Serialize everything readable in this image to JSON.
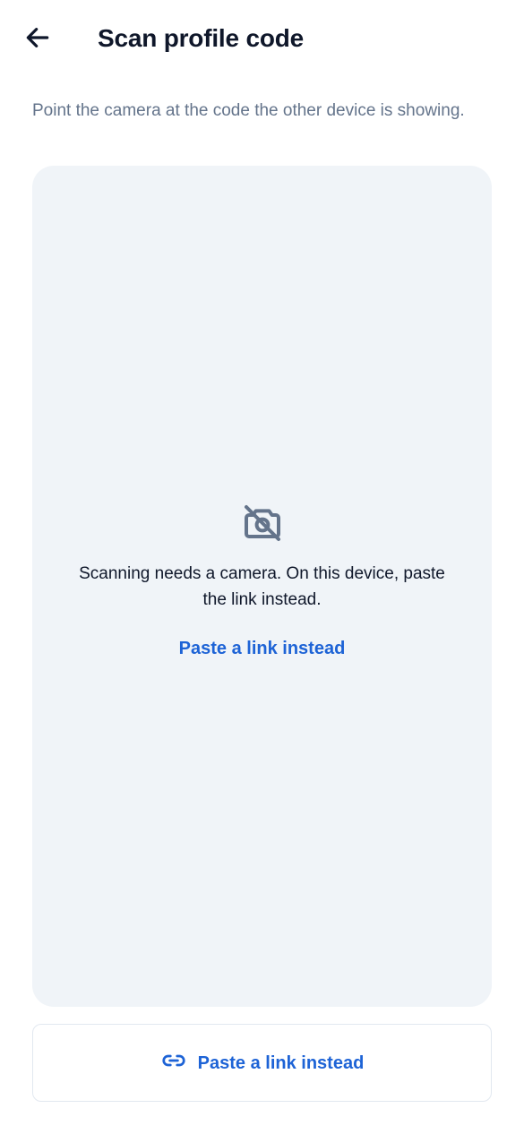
{
  "header": {
    "back_icon": "arrow-left-icon",
    "title": "Scan profile code"
  },
  "instruction": "Point the camera at the code the other device is showing.",
  "camera_panel": {
    "icon": "camera-off-icon",
    "message": "Scanning needs a camera. On this device, paste the link instead.",
    "link_label": "Paste a link instead"
  },
  "footer_button": {
    "icon": "link-icon",
    "label": "Paste a link instead"
  },
  "colors": {
    "accent": "#1d63d6",
    "title": "#0f172a",
    "muted_text": "#64748b",
    "panel_background": "#f0f4f8",
    "border": "#e2e8f0"
  }
}
